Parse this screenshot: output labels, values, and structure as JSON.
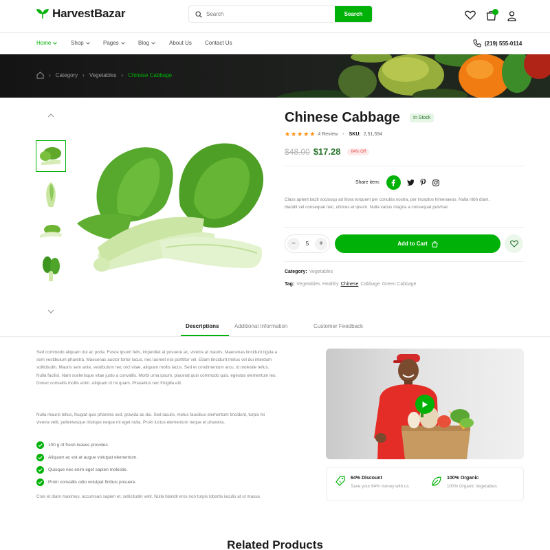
{
  "brand": {
    "name": "HarvestBazar",
    "accent": "#00b207"
  },
  "search": {
    "placeholder": "Search",
    "button_label": "Search"
  },
  "header_icons": [
    "heart-icon",
    "shopping-bag-icon",
    "user-icon"
  ],
  "nav": {
    "items": [
      {
        "label": "Home",
        "active": true,
        "dropdown": true
      },
      {
        "label": "Shop",
        "dropdown": true
      },
      {
        "label": "Pages",
        "dropdown": true
      },
      {
        "label": "Blog",
        "dropdown": true
      },
      {
        "label": "About Us",
        "dropdown": false
      },
      {
        "label": "Contact Us",
        "dropdown": false
      }
    ],
    "phone": "(219) 555-0114"
  },
  "breadcrumb": {
    "items": [
      "Category",
      "Vegetables"
    ],
    "current": "Chinese Cabbage"
  },
  "product": {
    "title": "Chinese Cabbage",
    "stock": "In Stock",
    "rating_stars": 5,
    "review_text": "4 Review",
    "sku_label": "SKU:",
    "sku": "2,51,594",
    "old_price": "$48.00",
    "new_price": "$17.28",
    "discount": "64% Off",
    "share_label": "Share item:",
    "description": "Class aptent taciti sociosqu ad litora torquent per conubia nostra, per inceptos himenaeos. Nulla nibh diam, blandit vel consequat nec, ultrices et ipsum. Nulla varius magna a consequat pulvinar.",
    "quantity": "5",
    "add_to_cart": "Add to Cart",
    "category_label": "Category:",
    "category_value": "Vegetables",
    "tag_label": "Tag:",
    "tags": [
      "Vegetables",
      "Healthy",
      "Chinese",
      "Cabbage",
      "Green Cabbage"
    ]
  },
  "tabs": [
    {
      "label": "Descriptions",
      "active": true
    },
    {
      "label": "Additional Information"
    },
    {
      "label": "Customer Feedback"
    }
  ],
  "details": {
    "para1": "Sed commodo aliquam dui ac porta. Fusce ipsum felis, imperdiet at posuere ac, viverra at mauris. Maecenas tincidunt ligula a sem vestibulum pharetra. Maecenas auctor tortor lacus, nec laoreet nisi porttitor vel. Etiam tincidunt metus vel dui interdum sollicitudin. Mauris sem ante, vestibulum nec orci vitae, aliquam mollis lacus. Sed et condimentum arcu, id molestie tellus. Nulla facilisi. Nam scelerisque vitae justo a convallis. Morbi urna ipsum, placerat quis commodo quis, egestas elementum leo. Donec convallis mollis enim. Aliquam id mi quam. Phasellus nec fringilla elit.",
    "para2": "Nulla mauris tellus, feugiat quis pharetra sed, gravida ac dui. Sed iaculis, metus faucibus elementum tincidunt, turpis mi viverra velit, pellentesque tristique neque mi eget nulla. Proin luctus elementum neque et pharetra.",
    "bullets": [
      "100 g of fresh leaves provides.",
      "Aliquam ac est at augue volutpat elementum.",
      "Quisque nec enim eget sapien molestie.",
      "Proin convallis odio volutpat finibus posuere."
    ],
    "para3": "Cras et diam maximus, accumsan sapien et, sollicitudin velit. Nulla blandit eros non turpis lobortis iaculis at ut massa."
  },
  "features": [
    {
      "title": "64% Discount",
      "sub": "Save your 64% money with us",
      "icon": "price-tag-icon"
    },
    {
      "title": "100% Organic",
      "sub": "100% Organic Vegetables",
      "icon": "leaf-icon"
    }
  ],
  "related": {
    "title": "Related Products"
  }
}
